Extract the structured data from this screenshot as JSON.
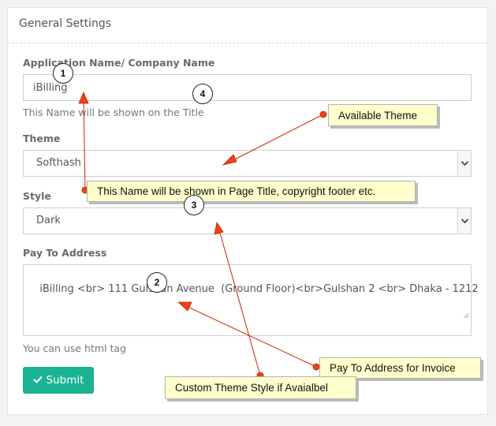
{
  "panel": {
    "title": "General Settings"
  },
  "form": {
    "app_name": {
      "label": "Application Name/ Company Name",
      "value": "iBilling",
      "help": "This Name will be shown on the Title"
    },
    "theme": {
      "label": "Theme",
      "selected": "Softhash"
    },
    "style": {
      "label": "Style",
      "selected": "Dark"
    },
    "pay_to": {
      "label": "Pay To Address",
      "value": "iBilling <br> 111 Gulshan Avenue  (Ground Floor)<br>Gulshan 2 <br> Dhaka - 1212",
      "help": "You can use html tag"
    },
    "submit_label": "Submit"
  },
  "annotations": {
    "callouts": {
      "available_theme": "Available Theme",
      "name_shown": "This Name will be shown in Page Title, copyright footer etc.",
      "pay_to_invoice": "Pay To Address for Invoice",
      "custom_style": "Custom Theme Style if Avaialbel"
    },
    "badges": {
      "one": "1",
      "two": "2",
      "three": "3",
      "four": "4"
    }
  },
  "colors": {
    "accent": "#1ab394",
    "callout_bg": "#ffffcc",
    "arrow": "#cc2200",
    "arrow_fill": "#e8431a"
  },
  "icons": {
    "select_caret": "chevron-down-icon",
    "submit": "check-icon",
    "resize": "resize-grip-icon"
  }
}
